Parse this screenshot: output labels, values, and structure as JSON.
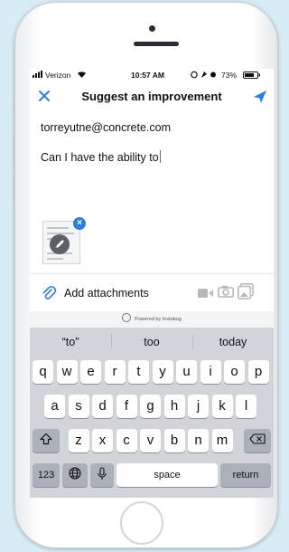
{
  "status_bar": {
    "carrier": "Verizon",
    "time": "10:57 AM",
    "battery": "73%"
  },
  "nav": {
    "title": "Suggest an improvement",
    "close_icon": "close-icon",
    "send_icon": "send-icon"
  },
  "form": {
    "email": "torreyutne@concrete.com",
    "message": "Can I have the ability to"
  },
  "attachments": {
    "label": "Add attachments",
    "icons": [
      "paperclip-icon",
      "video-camera-icon",
      "camera-icon",
      "gallery-icon"
    ]
  },
  "powered_by": "Powered by Instabug",
  "keyboard": {
    "suggestions": [
      "“to”",
      "too",
      "today"
    ],
    "row1": [
      "q",
      "w",
      "e",
      "r",
      "t",
      "y",
      "u",
      "i",
      "o",
      "p"
    ],
    "row2": [
      "a",
      "s",
      "d",
      "f",
      "g",
      "h",
      "j",
      "k",
      "l"
    ],
    "row3": [
      "z",
      "x",
      "c",
      "v",
      "b",
      "n",
      "m"
    ],
    "numbers_key": "123",
    "space_key": "space",
    "return_key": "return"
  },
  "colors": {
    "accent": "#2f7de1",
    "background": "#d7ecf4",
    "keyboard": "#d1d4d9"
  }
}
